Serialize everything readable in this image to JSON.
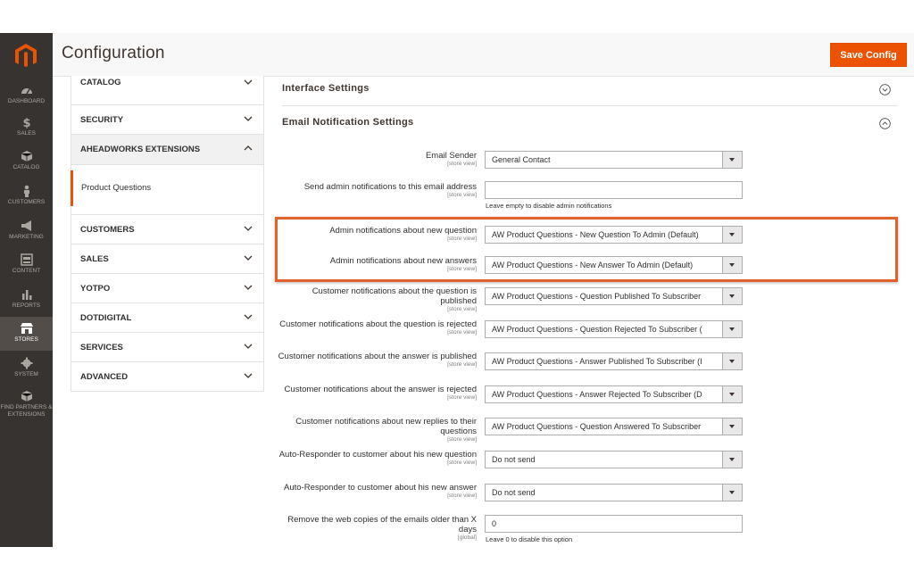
{
  "header": {
    "title": "Configuration",
    "save_label": "Save Config"
  },
  "nav": {
    "items": [
      {
        "label": "DASHBOARD"
      },
      {
        "label": "SALES"
      },
      {
        "label": "CATALOG"
      },
      {
        "label": "CUSTOMERS"
      },
      {
        "label": "MARKETING"
      },
      {
        "label": "CONTENT"
      },
      {
        "label": "REPORTS"
      },
      {
        "label": "STORES"
      },
      {
        "label": "SYSTEM"
      },
      {
        "label": "FIND PARTNERS & EXTENSIONS"
      }
    ]
  },
  "tabs": {
    "catalog": "CATALOG",
    "security": "SECURITY",
    "aheadworks": "AHEADWORKS EXTENSIONS",
    "product_questions": "Product Questions",
    "customers": "CUSTOMERS",
    "sales": "SALES",
    "yotpo": "YOTPO",
    "dotdigital": "DOTDIGITAL",
    "services": "SERVICES",
    "advanced": "ADVANCED"
  },
  "sections": {
    "interface": "Interface Settings",
    "email": "Email Notification Settings"
  },
  "fields": [
    {
      "label": "Email Sender",
      "scope": "[store view]",
      "value": "General Contact"
    },
    {
      "label": "Send admin notifications to this email address",
      "scope": "[store view]",
      "value": "",
      "note": "Leave empty to disable admin notifications"
    },
    {
      "label": "Admin notifications about new question",
      "scope": "[store view]",
      "value": "AW Product Questions - New Question To Admin (Default)"
    },
    {
      "label": "Admin notifications about new answers",
      "scope": "[store view]",
      "value": "AW Product Questions - New Answer To Admin (Default)"
    },
    {
      "label": "Customer notifications about the question is published",
      "scope": "[store view]",
      "value": "AW Product Questions - Question Published To Subscriber"
    },
    {
      "label": "Customer notifications about the question is rejected",
      "scope": "[store view]",
      "value": "AW Product Questions - Question Rejected To Subscriber ("
    },
    {
      "label": "Customer notifications about the answer is published",
      "scope": "[store view]",
      "value": "AW Product Questions - Answer Published To Subscriber (I"
    },
    {
      "label": "Customer notifications about the answer is rejected",
      "scope": "[store view]",
      "value": "AW Product Questions - Answer Rejected To Subscriber (D"
    },
    {
      "label": "Customer notifications about new replies to their questions",
      "scope": "[store view]",
      "value": "AW Product Questions - Question Answered To Subscriber"
    },
    {
      "label": "Auto-Responder to customer about his new question",
      "scope": "[store view]",
      "value": "Do not send"
    },
    {
      "label": "Auto-Responder to customer about his new answer",
      "scope": "[store view]",
      "value": "Do not send"
    },
    {
      "label": "Remove the web copies of the emails older than X days",
      "scope": "[global]",
      "value": "0",
      "note": "Leave 0 to disable this option"
    }
  ],
  "colors": {
    "accent": "#eb5202",
    "nav_bg": "#373330",
    "highlight": "#e0622a"
  }
}
